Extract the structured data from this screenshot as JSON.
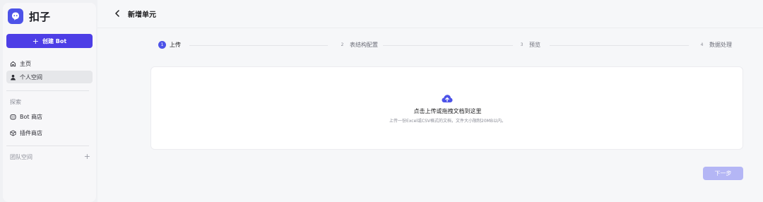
{
  "app": {
    "name": "扣子",
    "brand_color": "#4d53e8"
  },
  "sidebar": {
    "create_button": "创建 Bot",
    "nav": [
      {
        "label": "主页",
        "icon": "home-icon"
      },
      {
        "label": "个人空间",
        "icon": "user-icon",
        "active": true
      }
    ],
    "explore_label": "探索",
    "explore": [
      {
        "label": "Bot 商店",
        "icon": "bot-icon"
      },
      {
        "label": "插件商店",
        "icon": "cube-icon"
      }
    ],
    "team_label": "团队空间"
  },
  "header": {
    "title": "新增单元"
  },
  "steps": [
    {
      "num": "1",
      "label": "上传",
      "active": true
    },
    {
      "num": "2",
      "label": "表结构配置"
    },
    {
      "num": "3",
      "label": "预览"
    },
    {
      "num": "4",
      "label": "数据处理"
    }
  ],
  "upload": {
    "icon": "cloud-upload-icon",
    "title": "点击上传或拖拽文档到这里",
    "hint": "上传一份Excel或CSV格式的文档，文件大小限制20MB以内。"
  },
  "footer": {
    "next_button": "下一步"
  }
}
